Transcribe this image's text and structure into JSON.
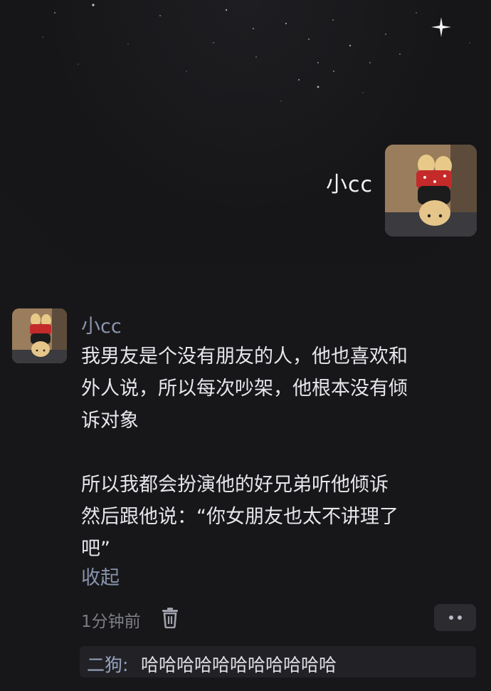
{
  "profile": {
    "name": "小cc"
  },
  "comment": {
    "author": "小cc",
    "paragraphs": [
      "我男友是个没有朋友的人，他也喜欢和\n外人说，所以每次吵架，他根本没有倾\n诉对象",
      "所以我都会扮演他的好兄弟听他倾诉\n然后跟他说：“你女朋友也太不讲理了\n吧”"
    ],
    "collapse_label": "收起",
    "timestamp": "1分钟前"
  },
  "reply": {
    "author": "二狗:",
    "text": "哈哈哈哈哈哈哈哈哈哈哈"
  },
  "colors": {
    "background": "#171719",
    "author_name": "#8b96ae",
    "body_text": "#e6e6ec",
    "muted": "#7c7d86"
  },
  "icons": {
    "delete": "trash-icon",
    "more": "more-dots-icon"
  }
}
